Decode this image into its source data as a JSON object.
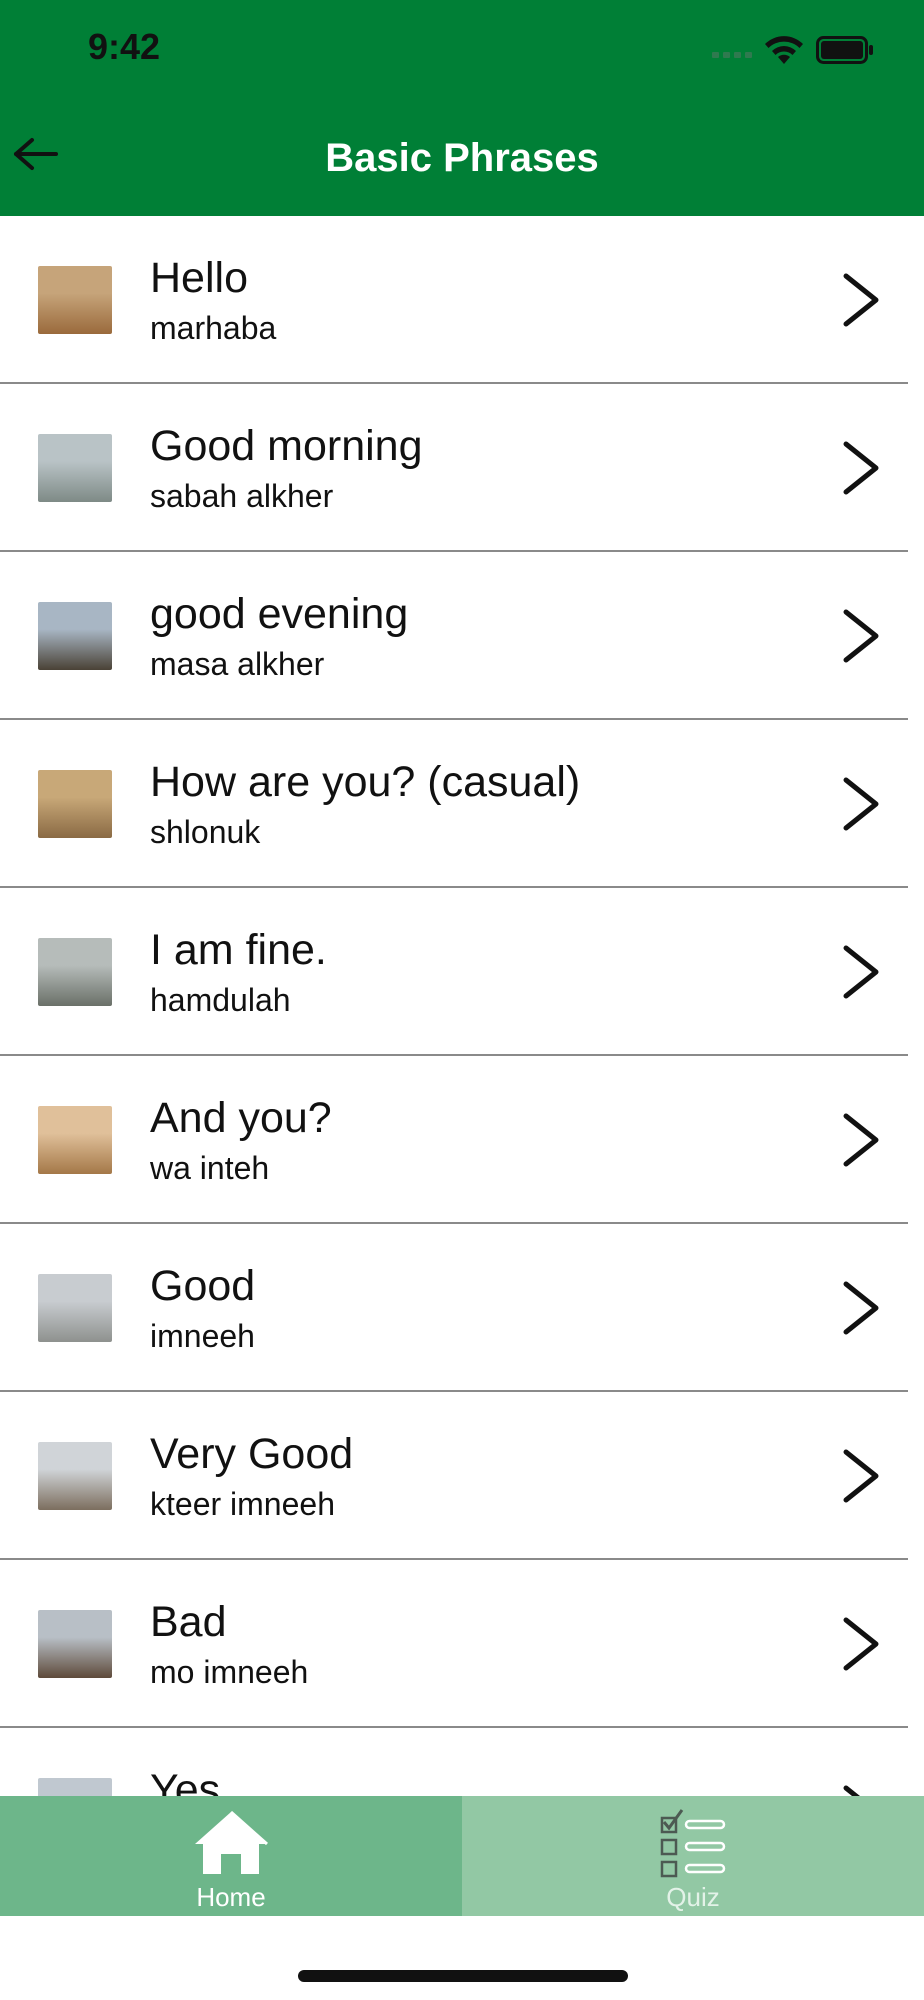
{
  "status_bar": {
    "time": "9:42"
  },
  "header": {
    "title": "Basic Phrases",
    "back_icon": "arrow-left-icon"
  },
  "phrases": [
    {
      "english": "Hello",
      "arabic": "marhaba",
      "thumb_colors": [
        "#c6a47a",
        "#9a6a3c"
      ]
    },
    {
      "english": "Good morning",
      "arabic": "sabah alkher",
      "thumb_colors": [
        "#b9c3c6",
        "#7e8a86"
      ]
    },
    {
      "english": "good evening",
      "arabic": "masa alkher",
      "thumb_colors": [
        "#a8b6c4",
        "#4a4236"
      ]
    },
    {
      "english": "How are you? (casual)",
      "arabic": "shlonuk",
      "thumb_colors": [
        "#c8a878",
        "#8a6a44"
      ]
    },
    {
      "english": "I am fine.",
      "arabic": "hamdulah",
      "thumb_colors": [
        "#b6bcba",
        "#6a7068"
      ]
    },
    {
      "english": "And you?",
      "arabic": "wa inteh",
      "thumb_colors": [
        "#e0c09a",
        "#a47848"
      ]
    },
    {
      "english": "Good",
      "arabic": "imneeh",
      "thumb_colors": [
        "#c8ccd0",
        "#8e918e"
      ]
    },
    {
      "english": "Very Good",
      "arabic": "kteer imneeh",
      "thumb_colors": [
        "#d0d4d8",
        "#7c6e5e"
      ]
    },
    {
      "english": "Bad",
      "arabic": "mo imneeh",
      "thumb_colors": [
        "#b8bfc6",
        "#5e4a3a"
      ]
    },
    {
      "english": "Yes",
      "arabic": "",
      "thumb_colors": [
        "#c0c8d0",
        "#8a8f94"
      ]
    }
  ],
  "tabbar": {
    "tabs": [
      {
        "label": "Home",
        "icon": "home-icon",
        "selected": true
      },
      {
        "label": "Quiz",
        "icon": "checklist-icon",
        "selected": false
      }
    ]
  },
  "colors": {
    "header_bg": "#007f36",
    "tab_home_bg": "#6db68a",
    "tab_quiz_bg": "#92c8a4"
  }
}
